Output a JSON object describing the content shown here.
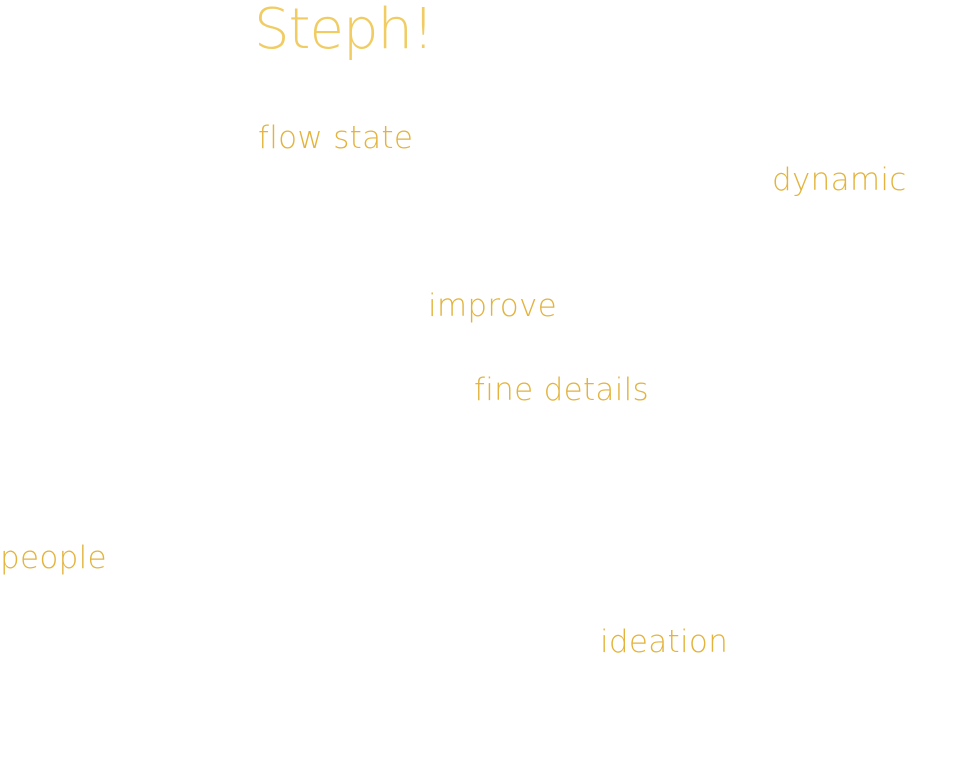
{
  "colors": {
    "accent": "#e3b33b",
    "heading": "#f0cc62",
    "background": "#ffffff"
  },
  "heading": "Steph!",
  "words": {
    "flow_state": "flow state",
    "dynamic": "dynamic",
    "improve": "improve",
    "fine_details": "fine details",
    "people": "people",
    "ideation": "ideation"
  }
}
